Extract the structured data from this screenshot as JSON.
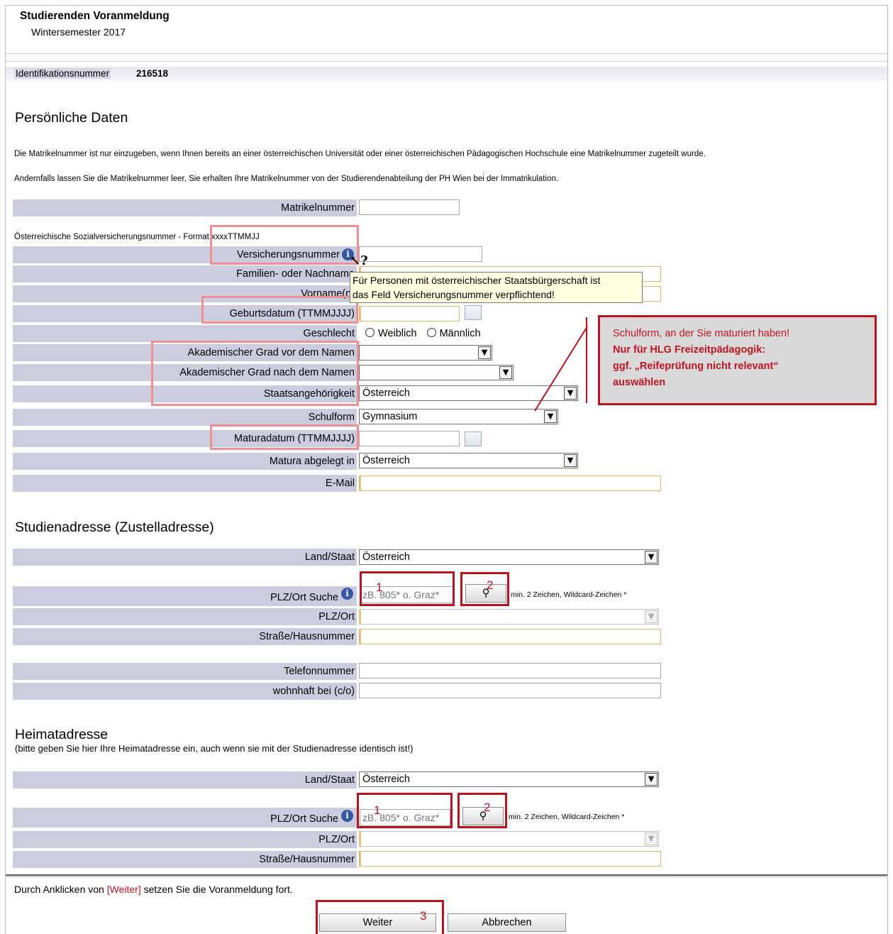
{
  "header": {
    "title": "Studierenden Voranmeldung",
    "semester": "Wintersemester 2017"
  },
  "ident": {
    "label": "Identifikationsnummer",
    "value": "216518"
  },
  "personal": {
    "title": "Persönliche Daten",
    "note1": "Die Matrikelnummer ist nur einzugeben, wenn Ihnen bereits an einer österreichischen Universität oder einer österreichischen Pädagogischen Hochschule eine Matrikelnummer zugeteilt wurde.",
    "note2": "Andernfalls lassen Sie die Matrikelnummer leer, Sie erhalten Ihre Matrikelnummer von der Studierendenabteilung der PH Wien bei der Immatrikulation.",
    "matrikel_label": "Matrikelnummer",
    "svnr_note": "Österreichische Sozialversicherungsnummer - Format xxxxTTMMJJ",
    "svnr_label": "Versicherungsnummer",
    "familienname_label": "Familien- oder Nachname",
    "vorname_label": "Vorname(n)",
    "geburtsdatum_label": "Geburtsdatum (TTMMJJJJ)",
    "geschlecht_label": "Geschlecht",
    "weiblich": "Weiblich",
    "maennlich": "Männlich",
    "grad_vor_label": "Akademischer Grad vor dem Namen",
    "grad_nach_label": "Akademischer Grad nach dem Namen",
    "staat_label": "Staatsangehörigkeit",
    "staat_value": "Österreich",
    "schulform_label": "Schulform",
    "schulform_value": "Gymnasium",
    "maturadatum_label": "Maturadatum (TTMMJJJJ)",
    "matura_in_label": "Matura abgelegt in",
    "matura_in_value": "Österreich",
    "email_label": "E-Mail"
  },
  "tooltip": {
    "line1": "Für Personen mit österreichischer Staatsbürgerschaft ist",
    "line2": "das Feld Versicherungsnummer verpflichtend!"
  },
  "callout": {
    "line1": "Schulform, an der Sie maturiert haben!",
    "line2": "Nur für HLG Freizeitpädagogik:",
    "line3": "ggf. „Reifeprüfung nicht relevant“",
    "line4": "auswählen"
  },
  "studienadresse": {
    "title": "Studienadresse (Zustelladresse)",
    "land_label": "Land/Staat",
    "land_value": "Österreich",
    "plz_suche_label": "PLZ/Ort Suche",
    "plz_suche_placeholder": "zB. 805* o. Graz*",
    "plz_hint": "min. 2 Zeichen, Wildcard-Zeichen *",
    "plz_ort_label": "PLZ/Ort",
    "strasse_label": "Straße/Hausnummer",
    "telefon_label": "Telefonnummer",
    "wohnhaft_label": "wohnhaft bei (c/o)"
  },
  "heimatadresse": {
    "title": "Heimatadresse",
    "subtitle": "(bitte geben Sie hier Ihre Heimatadresse ein, auch wenn sie mit der Studienadresse identisch ist!)",
    "land_label": "Land/Staat",
    "land_value": "Österreich",
    "plz_suche_label": "PLZ/Ort Suche",
    "plz_suche_placeholder": "zB. 805* o. Graz*",
    "plz_hint": "min. 2 Zeichen, Wildcard-Zeichen *",
    "plz_ort_label": "PLZ/Ort",
    "strasse_label": "Straße/Hausnummer"
  },
  "footer": {
    "text_before": "Durch Anklicken von ",
    "link": "[Weiter]",
    "text_after": " setzen Sie die Voranmeldung fort.",
    "weiter": "Weiter",
    "abbrechen": "Abbrechen"
  },
  "annotations": {
    "n1": "1",
    "n2": "2",
    "n3": "3"
  }
}
